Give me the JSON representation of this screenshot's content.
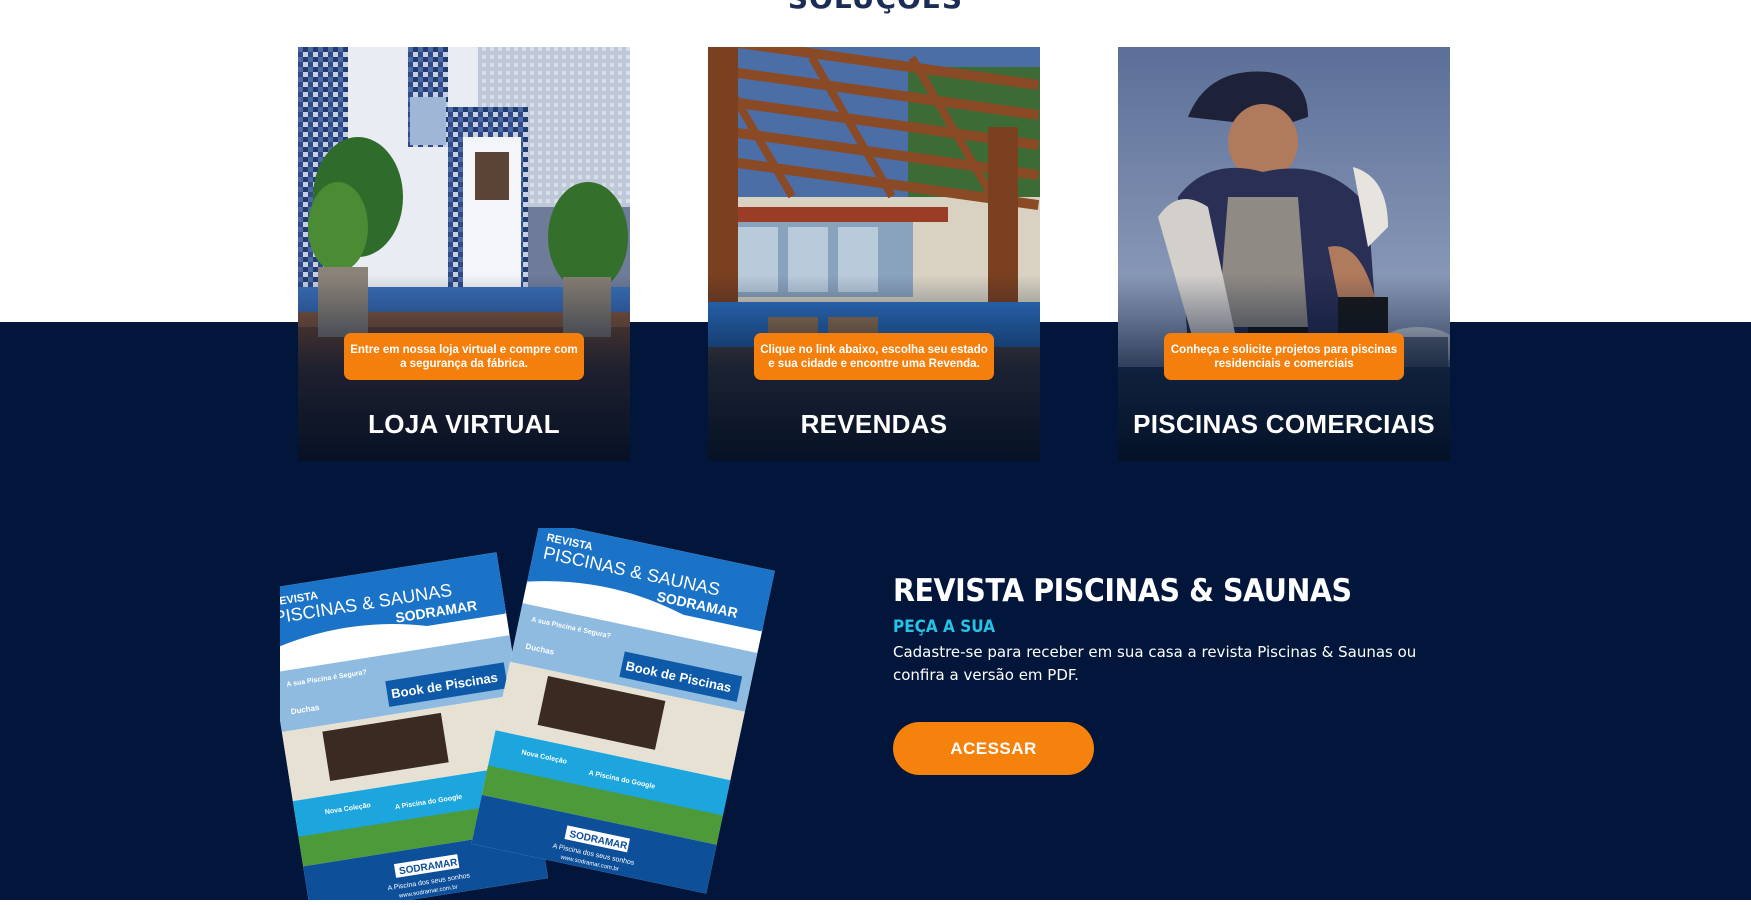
{
  "section": {
    "title": "SOLUÇÕES"
  },
  "cards": [
    {
      "title": "LOJA VIRTUAL",
      "badge": "Entre em nossa loja virtual e compre com a segurança da fábrica."
    },
    {
      "title": "REVENDAS",
      "badge": "Clique no link abaixo, escolha seu estado e sua cidade e encontre uma Revenda."
    },
    {
      "title": "PISCINAS COMERCIAIS",
      "badge": "Conheça e solicite projetos para piscinas residenciais e comerciais"
    }
  ],
  "magazine": {
    "cover_title_small": "REVISTA",
    "cover_title_big": "PISCINAS & SAUNAS",
    "cover_brand": "SODRAMAR",
    "cover_book": "Book de Piscinas",
    "cover_google": "A Piscina do Google",
    "cover_colecao": "Nova Coleção",
    "cover_duchas": "Duchas",
    "cover_segura": "A sua Piscina é Segura?",
    "cover_sonhos": "A Piscina dos seus sonhos",
    "cover_url": "www.sodramar.com.br"
  },
  "promo": {
    "title": "REVISTA PISCINAS & SAUNAS",
    "subtitle": "PEÇA A SUA",
    "text": "Cadastre-se para receber em sua casa a revista Piscinas & Saunas ou confira a versão em PDF.",
    "button_label": "ACESSAR"
  },
  "colors": {
    "navy": "#01163a",
    "orange": "#f57f0c",
    "cyan": "#27c3e6",
    "heading": "#1b2d55"
  }
}
